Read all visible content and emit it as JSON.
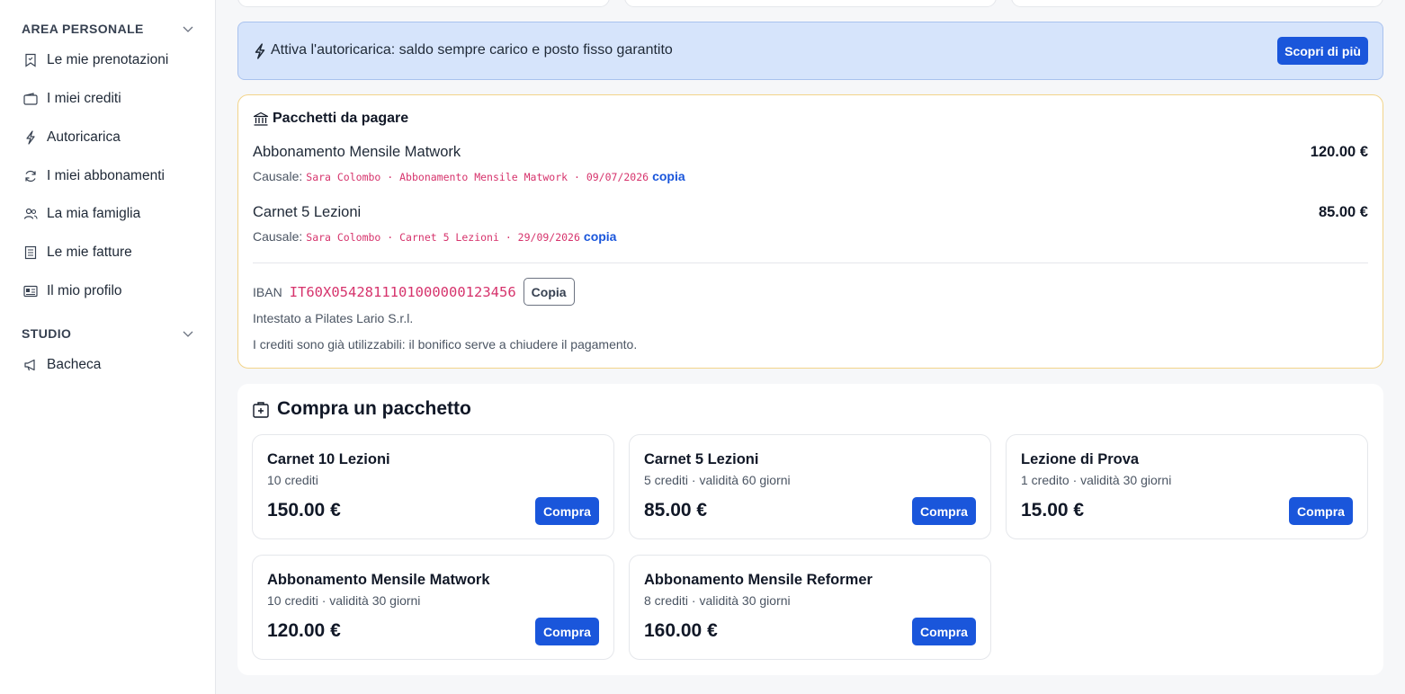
{
  "sidebar": {
    "sections": [
      {
        "label": "AREA PERSONALE",
        "items": [
          {
            "label": "Le mie prenotazioni",
            "icon": "bookmark-icon"
          },
          {
            "label": "I miei crediti",
            "icon": "wallet-icon"
          },
          {
            "label": "Autoricarica",
            "icon": "lightning-icon"
          },
          {
            "label": "I miei abbonamenti",
            "icon": "refresh-icon"
          },
          {
            "label": "La mia famiglia",
            "icon": "people-icon"
          },
          {
            "label": "Le mie fatture",
            "icon": "receipt-icon"
          },
          {
            "label": "Il mio profilo",
            "icon": "id-card-icon"
          }
        ]
      },
      {
        "label": "STUDIO",
        "items": [
          {
            "label": "Bacheca",
            "icon": "megaphone-icon"
          }
        ]
      }
    ]
  },
  "banner": {
    "text": "Attiva l'autoricarica: saldo sempre carico e posto fisso garantito",
    "button": "Scopri di più",
    "icon": "lightning-icon"
  },
  "payments": {
    "title": "Pacchetti da pagare",
    "icon": "bank-icon",
    "causale_label": "Causale:",
    "copy_link": "copia",
    "items": [
      {
        "name": "Abbonamento Mensile Matwork",
        "price": "120.00 €",
        "causale": "Sara Colombo · Abbonamento Mensile Matwork · 09/07/2026"
      },
      {
        "name": "Carnet 5 Lezioni",
        "price": "85.00 €",
        "causale": "Sara Colombo · Carnet 5 Lezioni · 29/09/2026"
      }
    ],
    "iban_label": "IBAN",
    "iban": "IT60X0542811101000000123456",
    "iban_copy": "Copia",
    "holder": "Intestato a Pilates Lario S.r.l.",
    "note": "I crediti sono già utilizzabili: il bonifico serve a chiudere il pagamento."
  },
  "buy": {
    "title": "Compra un pacchetto",
    "icon": "bag-plus-icon",
    "button": "Compra",
    "packages": [
      {
        "name": "Carnet 10 Lezioni",
        "desc": "10 crediti",
        "price": "150.00 €"
      },
      {
        "name": "Carnet 5 Lezioni",
        "desc": "5 crediti · validità 60 giorni",
        "price": "85.00 €"
      },
      {
        "name": "Lezione di Prova",
        "desc": "1 credito · validità 30 giorni",
        "price": "15.00 €"
      },
      {
        "name": "Abbonamento Mensile Matwork",
        "desc": "10 crediti · validità 30 giorni",
        "price": "120.00 €"
      },
      {
        "name": "Abbonamento Mensile Reformer",
        "desc": "8 crediti · validità 30 giorni",
        "price": "160.00 €"
      }
    ]
  },
  "colors": {
    "primary": "#1a56db",
    "banner_bg": "#d6e4fb",
    "warning_border": "#f2d48a",
    "mono_text": "#d6336c"
  }
}
